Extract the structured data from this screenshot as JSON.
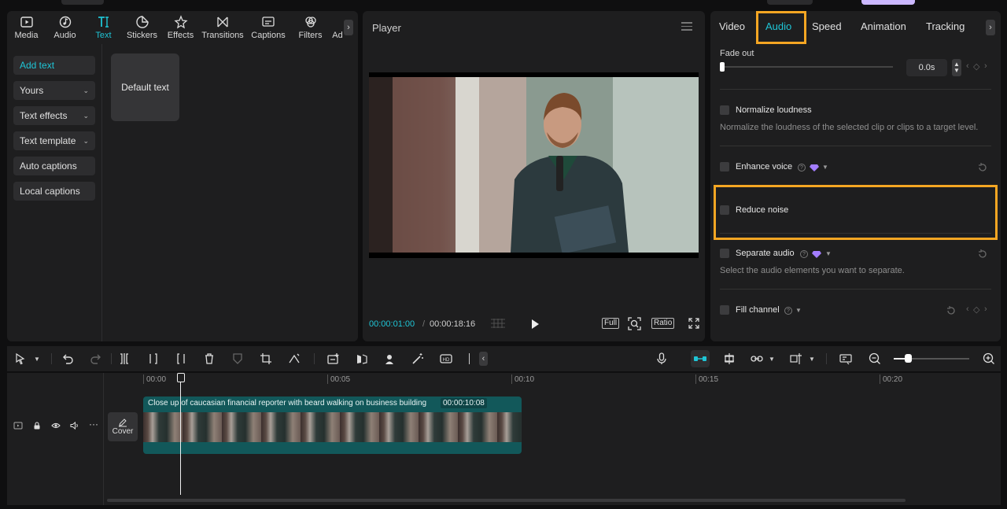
{
  "left_tabs": [
    {
      "label": "Media",
      "icon": "media-icon"
    },
    {
      "label": "Audio",
      "icon": "audio-icon"
    },
    {
      "label": "Text",
      "icon": "text-icon"
    },
    {
      "label": "Stickers",
      "icon": "stickers-icon"
    },
    {
      "label": "Effects",
      "icon": "effects-icon"
    },
    {
      "label": "Transitions",
      "icon": "transitions-icon"
    },
    {
      "label": "Captions",
      "icon": "captions-icon"
    },
    {
      "label": "Filters",
      "icon": "filters-icon"
    },
    {
      "label": "Ad",
      "icon": "adjust-icon"
    }
  ],
  "left_menu": {
    "add_text": "Add text",
    "yours": "Yours",
    "text_effects": "Text effects",
    "text_template": "Text template",
    "auto_captions": "Auto captions",
    "local_captions": "Local captions"
  },
  "default_text_card": "Default text",
  "player": {
    "title": "Player",
    "current_time": "00:00:01:00",
    "separator": "/",
    "total_time": "00:00:18:16",
    "full_label": "Full",
    "ratio_label": "Ratio"
  },
  "right_tabs": {
    "video": "Video",
    "audio": "Audio",
    "speed": "Speed",
    "animation": "Animation",
    "tracking": "Tracking"
  },
  "audio": {
    "fade_out_label": "Fade out",
    "fade_out_value": "0.0s",
    "fade_out_level": 0,
    "normalize_title": "Normalize loudness",
    "normalize_desc": "Normalize the loudness of the selected clip or clips to a target level.",
    "enhance_title": "Enhance voice",
    "reduce_title": "Reduce noise",
    "separate_title": "Separate audio",
    "separate_desc": "Select the audio elements you want to separate.",
    "fill_title": "Fill channel"
  },
  "ruler": [
    "00:00",
    "00:05",
    "00:10",
    "00:15",
    "00:20"
  ],
  "clip": {
    "name": "Close up of caucasian financial reporter with beard walking on business building",
    "duration": "00:00:10:08"
  },
  "cover_label": "Cover",
  "colors": {
    "accent": "#1fc5d6",
    "highlight": "#f5a623",
    "clip": "#12585a",
    "premium": "#a37dff"
  }
}
